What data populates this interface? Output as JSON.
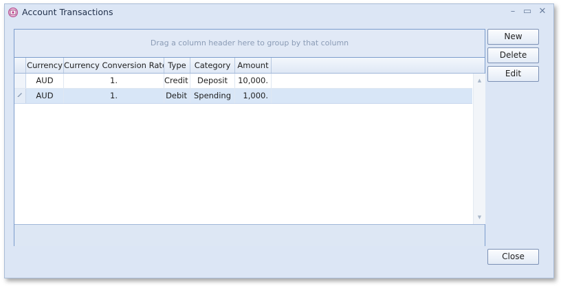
{
  "window": {
    "title": "Account Transactions",
    "controls": {
      "minimize": "–",
      "maximize": "▭",
      "close": "✕"
    }
  },
  "grid": {
    "group_panel_text": "Drag a column header here to group by that column",
    "columns": [
      "Currency",
      "Currency Conversion Rate",
      "Type",
      "Category",
      "Amount"
    ],
    "rows": [
      {
        "currency": "AUD",
        "rate": "1.",
        "type": "Credit",
        "category": "Deposit",
        "amount": "10,000.",
        "selected": false
      },
      {
        "currency": "AUD",
        "rate": "1.",
        "type": "Debit",
        "category": "Spending",
        "amount": "1,000.",
        "selected": true
      }
    ],
    "scroll_up": "▲",
    "scroll_down": "▼"
  },
  "buttons": {
    "new": "New",
    "delete": "Delete",
    "edit": "Edit",
    "close": "Close"
  },
  "colors": {
    "window_bg": "#dce6f5",
    "selected_row": "#d8e6f7",
    "border": "#7b9ccc"
  }
}
